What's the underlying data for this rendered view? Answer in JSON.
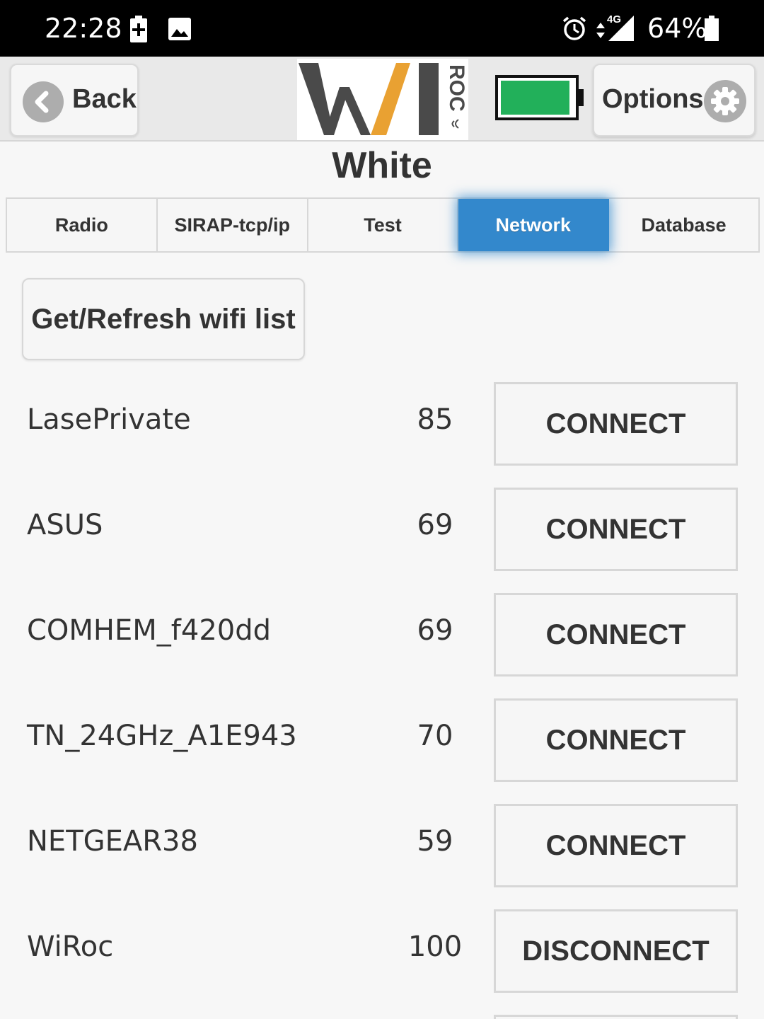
{
  "status_bar": {
    "time": "22:28",
    "battery_percent": "64%",
    "network_type": "4G",
    "icons": [
      "battery-saver-icon",
      "image-icon",
      "alarm-icon",
      "data-arrows-icon",
      "signal-icon",
      "battery-icon"
    ]
  },
  "header": {
    "back_label": "Back",
    "options_label": "Options",
    "logo_text": "WIROC",
    "battery_level": 0.95,
    "battery_color": "#22b05a"
  },
  "device_name": "White",
  "tabs": [
    {
      "label": "Radio",
      "active": false
    },
    {
      "label": "SIRAP-tcp/ip",
      "active": false
    },
    {
      "label": "Test",
      "active": false
    },
    {
      "label": "Network",
      "active": true
    },
    {
      "label": "Database",
      "active": false
    }
  ],
  "refresh_label": "Get/Refresh wifi list",
  "networks": [
    {
      "ssid": "LasePrivate",
      "signal": "85",
      "action": "CONNECT"
    },
    {
      "ssid": "ASUS",
      "signal": "69",
      "action": "CONNECT"
    },
    {
      "ssid": "COMHEM_f420dd",
      "signal": "69",
      "action": "CONNECT"
    },
    {
      "ssid": "TN_24GHz_A1E943",
      "signal": "70",
      "action": "CONNECT"
    },
    {
      "ssid": "NETGEAR38",
      "signal": "59",
      "action": "CONNECT"
    },
    {
      "ssid": "WiRoc",
      "signal": "100",
      "action": "DISCONNECT"
    }
  ],
  "colors": {
    "accent": "#3388cc",
    "logo_dark": "#4a4a4a",
    "logo_orange": "#e9a132"
  }
}
